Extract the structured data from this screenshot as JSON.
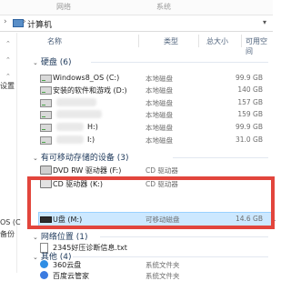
{
  "topbar": {
    "left": "网络",
    "right": "系统"
  },
  "address": {
    "breadcrumb": "计算机"
  },
  "columns": {
    "name": "名称",
    "type": "类型",
    "total": "总大小",
    "free": "可用空间"
  },
  "sidebar": {
    "item1": "设置",
    "item2": "OS (C",
    "item3": "备份"
  },
  "groups": {
    "hdd": "硬盘 (6)",
    "removable": "有可移动存储的设备 (3)",
    "network": "网络位置 (1)",
    "other": "其他 (4)"
  },
  "hdd_rows": [
    {
      "name": "Windows8_OS (C:)",
      "type": "本地磁盘",
      "size": "99.9 GB"
    },
    {
      "name": "安装的软件和游戏 (D:)",
      "type": "本地磁盘",
      "size": "140 GB"
    },
    {
      "name": "",
      "type": "本地磁盘",
      "size": "157 GB"
    },
    {
      "name": "",
      "type": "本地磁盘",
      "size": "159 GB"
    },
    {
      "name": "H:)",
      "type": "本地磁盘",
      "size": "99.9 GB"
    },
    {
      "name": "I:)",
      "type": "本地磁盘",
      "size": "31.0 GB"
    }
  ],
  "removable_rows": [
    {
      "name": "DVD RW 驱动器 (F:)",
      "type": "CD 驱动器",
      "size": ""
    },
    {
      "name": "CD 驱动器 (K:)",
      "type": "CD 驱动器",
      "size": ""
    },
    {
      "name": "U盘 (M:)",
      "type": "可移动磁盘",
      "size": "14.6 GB",
      "extra": "1"
    }
  ],
  "network_rows": [
    {
      "name": "2345好压诊断信息.txt",
      "type": "",
      "size": ""
    }
  ],
  "other_rows": [
    {
      "name": "360云盘",
      "type": "系统文件夹",
      "size": ""
    },
    {
      "name": "百度云管家",
      "type": "系统文件夹",
      "size": ""
    }
  ]
}
